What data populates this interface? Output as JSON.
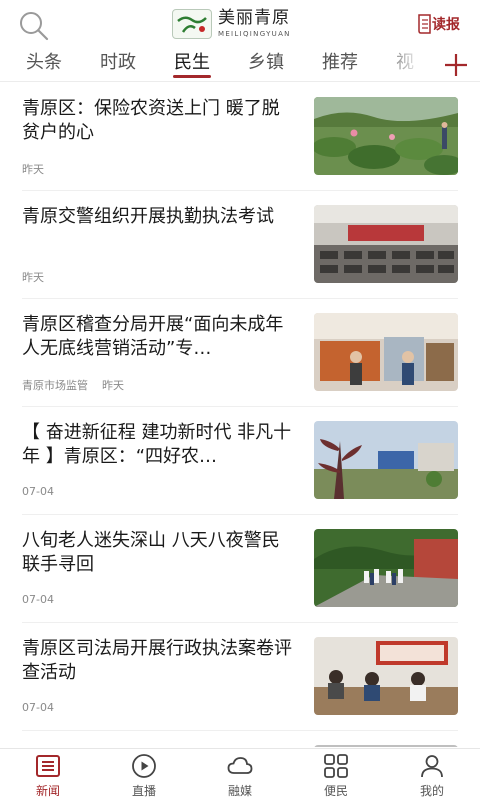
{
  "header": {
    "logo_text": "美丽青原",
    "logo_subtext": "MEILIQINGYUAN",
    "read_label": "读报"
  },
  "tabs": [
    {
      "label": "头条",
      "active": false
    },
    {
      "label": "时政",
      "active": false
    },
    {
      "label": "民生",
      "active": true
    },
    {
      "label": "乡镇",
      "active": false
    },
    {
      "label": "推荐",
      "active": false
    },
    {
      "label": "视",
      "active": false
    }
  ],
  "feed": [
    {
      "title": "青原区：保险农资送上门 暖了脱贫户的心",
      "source": "",
      "time": "昨天"
    },
    {
      "title": "青原交警组织开展执勤执法考试",
      "source": "",
      "time": "昨天"
    },
    {
      "title": "青原区稽查分局开展“面向未成年人无底线营销活动”专…",
      "source": "青原市场监管",
      "time": "昨天"
    },
    {
      "title": "【 奋进新征程 建功新时代 非凡十年 】青原区：“四好农…",
      "source": "",
      "time": "07-04"
    },
    {
      "title": "八旬老人迷失深山 八天八夜警民联手寻回",
      "source": "",
      "time": "07-04"
    },
    {
      "title": "青原区司法局开展行政执法案卷评查活动",
      "source": "",
      "time": "07-04"
    },
    {
      "title": "",
      "source": "",
      "time": ""
    }
  ],
  "bottom_nav": [
    {
      "label": "新闻",
      "icon": "news-icon",
      "active": true
    },
    {
      "label": "直播",
      "icon": "play-icon",
      "active": false
    },
    {
      "label": "融媒",
      "icon": "cloud-icon",
      "active": false
    },
    {
      "label": "便民",
      "icon": "grid-icon",
      "active": false
    },
    {
      "label": "我的",
      "icon": "user-icon",
      "active": false
    }
  ],
  "colors": {
    "accent": "#a3282b",
    "text": "#1a1a1a",
    "meta": "#8a8a8a"
  }
}
